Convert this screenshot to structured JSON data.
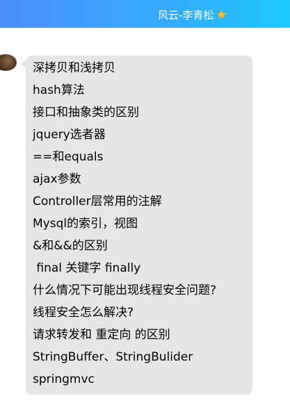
{
  "header": {
    "title": "风云-李青松",
    "star_icon": "star-icon"
  },
  "message": {
    "lines": [
      "深拷贝和浅拷贝",
      "hash算法",
      "接口和抽象类的区别",
      "jquery选者器",
      "==和equals",
      "ajax参数",
      "Controller层常用的注解",
      "Mysql的索引，视图",
      "&和&&的区别",
      " final 关键字 finally",
      "什么情况下可能出现线程安全问题?",
      "线程安全怎么解决?",
      "请求转发和 重定向 的区别",
      "StringBuffer、StringBulider",
      "springmvc"
    ]
  },
  "colors": {
    "header_gradient_start": "#4b8ff6",
    "header_gradient_end": "#1ec8fd",
    "bubble_bg": "#e6e6e6",
    "text": "#000000"
  }
}
